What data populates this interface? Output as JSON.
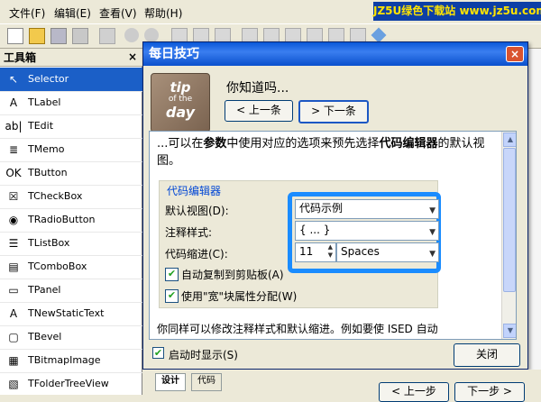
{
  "menubar": {
    "items": [
      {
        "label": "文件(F)"
      },
      {
        "label": "编辑(E)"
      },
      {
        "label": "查看(V)"
      },
      {
        "label": "帮助(H)"
      }
    ],
    "watermark": "JZ5U绿色下载站 www.jz5u.com"
  },
  "toolbox": {
    "title": "工具箱",
    "close_symbol": "×",
    "items": [
      {
        "label": "Selector",
        "icon": "cursor-icon",
        "glyph": "↖"
      },
      {
        "label": "TLabel",
        "icon": "label-icon",
        "glyph": "A"
      },
      {
        "label": "TEdit",
        "icon": "edit-icon",
        "glyph": "ab|"
      },
      {
        "label": "TMemo",
        "icon": "memo-icon",
        "glyph": "≣"
      },
      {
        "label": "TButton",
        "icon": "button-icon",
        "glyph": "OK"
      },
      {
        "label": "TCheckBox",
        "icon": "checkbox-icon",
        "glyph": "☒"
      },
      {
        "label": "TRadioButton",
        "icon": "radio-icon",
        "glyph": "◉"
      },
      {
        "label": "TListBox",
        "icon": "listbox-icon",
        "glyph": "☰"
      },
      {
        "label": "TComboBox",
        "icon": "combobox-icon",
        "glyph": "▤"
      },
      {
        "label": "TPanel",
        "icon": "panel-icon",
        "glyph": "▭"
      },
      {
        "label": "TNewStaticText",
        "icon": "static-text-icon",
        "glyph": "A"
      },
      {
        "label": "TBevel",
        "icon": "bevel-icon",
        "glyph": "▢"
      },
      {
        "label": "TBitmapImage",
        "icon": "image-icon",
        "glyph": "▦"
      },
      {
        "label": "TFolderTreeView",
        "icon": "folder-tree-icon",
        "glyph": "▧"
      }
    ]
  },
  "dialog": {
    "title": "每日技巧",
    "close_symbol": "×",
    "logo": {
      "line1": "tip",
      "line2": "of the",
      "line3": "day"
    },
    "heading": "你知道吗...",
    "prev_label": "< 上一条",
    "next_label": "> 下一条",
    "tip": {
      "text_part1": "...可以在",
      "bold1": "参数",
      "text_part2": "中使用对应的选项来预先选择",
      "bold2": "代码编辑器",
      "text_part3": "的默认视图。",
      "more": "你同样可以修改注释样式和默认缩进。例如要使 ISED 自动"
    },
    "group": {
      "title": "代码编辑器",
      "default_view_label": "默认视图(D):",
      "default_view_value": "代码示例",
      "comment_style_label": "注释样式:",
      "comment_style_value": "{ ... }",
      "indent_label": "代码缩进(C):",
      "indent_value": "11",
      "indent_unit": "Spaces",
      "auto_copy_label": "自动复制到剪贴板(A)",
      "wide_label": "使用\"宽\"块属性分配(W)"
    },
    "startup_label": "启动时显示(S)",
    "close_label": "关闭"
  },
  "bottom": {
    "tab1": "设计",
    "tab2": "代码",
    "prev": "< 上一步",
    "next": "下一步 >"
  }
}
